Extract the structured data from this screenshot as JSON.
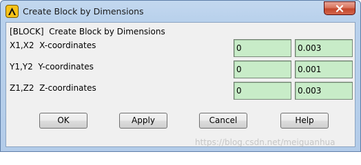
{
  "window": {
    "title": "Create Block by Dimensions",
    "app_icon": "ansys-logo-icon",
    "close_icon": "close-icon"
  },
  "dialog": {
    "header": "[BLOCK]  Create Block by Dimensions",
    "rows": [
      {
        "label": "X1,X2  X-coordinates",
        "value1": "0",
        "value2": "0.003"
      },
      {
        "label": "Y1,Y2  Y-coordinates",
        "value1": "0",
        "value2": "0.001"
      },
      {
        "label": "Z1,Z2  Z-coordinates",
        "value1": "0",
        "value2": "0.003"
      }
    ],
    "buttons": {
      "ok": "OK",
      "apply": "Apply",
      "cancel": "Cancel",
      "help": "Help"
    }
  },
  "watermark": "https://blog.csdn.net/meiguanhua",
  "colors": {
    "title_bar": "#b9d1ec",
    "client_bg": "#f0f0f0",
    "field_bg": "#c8ecc8",
    "close_button": "#c4472c"
  }
}
